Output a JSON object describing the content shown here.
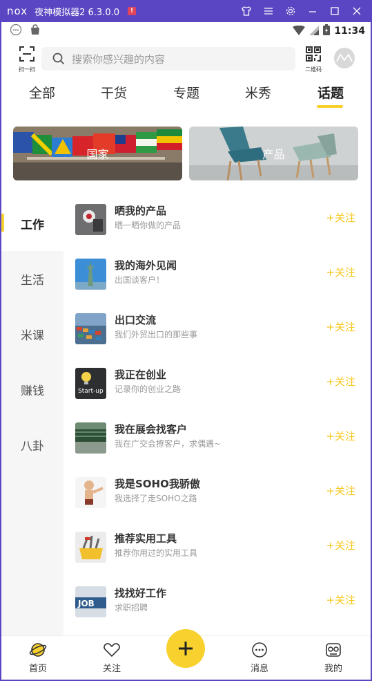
{
  "emulator": {
    "logo": "nox",
    "title": "夜神模拟器2 6.3.0.0",
    "controls": [
      "shirt-icon",
      "menu-icon",
      "gear-icon",
      "minimize-icon",
      "maximize-icon",
      "close-icon"
    ]
  },
  "status_bar": {
    "time": "11:34"
  },
  "topbar": {
    "scan_label": "扫一扫",
    "search_placeholder": "搜索你感兴趣的内容",
    "qr_label": "二维码"
  },
  "tabs": [
    {
      "label": "全部",
      "active": false
    },
    {
      "label": "干货",
      "active": false
    },
    {
      "label": "专题",
      "active": false
    },
    {
      "label": "米秀",
      "active": false
    },
    {
      "label": "话题",
      "active": true
    }
  ],
  "banners": [
    {
      "label": "国家"
    },
    {
      "label": "产品"
    }
  ],
  "side_categories": [
    {
      "label": "工作",
      "active": true
    },
    {
      "label": "生活",
      "active": false
    },
    {
      "label": "米课",
      "active": false
    },
    {
      "label": "赚钱",
      "active": false
    },
    {
      "label": "八卦",
      "active": false
    }
  ],
  "topics": [
    {
      "title": "晒我的产品",
      "subtitle": "晒一晒你做的产品",
      "follow": "+关注"
    },
    {
      "title": "我的海外见闻",
      "subtitle": "出国谈客户！",
      "follow": "+关注"
    },
    {
      "title": "出口交流",
      "subtitle": "我们外贸出口的那些事",
      "follow": "+关注"
    },
    {
      "title": "我正在创业",
      "subtitle": "记录你的创业之路",
      "follow": "+关注"
    },
    {
      "title": "我在展会找客户",
      "subtitle": "我在广交会撩客户，求偶遇~",
      "follow": "+关注"
    },
    {
      "title": "我是SOHO我骄傲",
      "subtitle": "我选择了走SOHO之路",
      "follow": "+关注"
    },
    {
      "title": "推荐实用工具",
      "subtitle": "推荐你用过的实用工具",
      "follow": "+关注"
    },
    {
      "title": "找找好工作",
      "subtitle": "求职招聘",
      "follow": "+关注"
    }
  ],
  "bottom_nav": {
    "home": "首页",
    "follow": "关注",
    "messages": "消息",
    "mine": "我的"
  },
  "colors": {
    "accent": "#f8d12f",
    "emulator_bar": "#5a46c2",
    "follow_text": "#f6c71e"
  }
}
